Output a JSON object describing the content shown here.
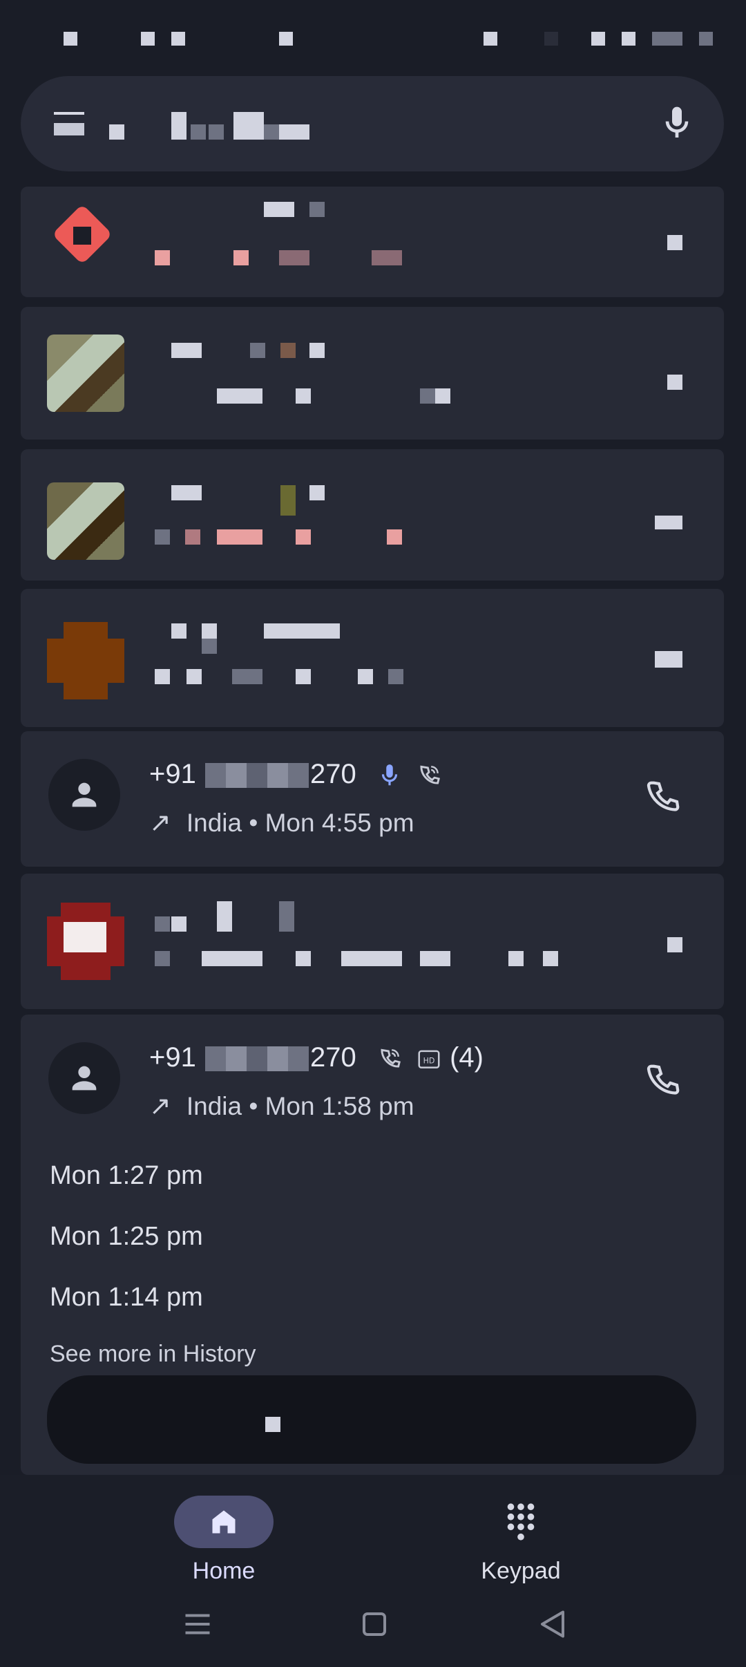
{
  "search": {
    "placeholder": "Search contacts",
    "mic_icon": "mic-icon"
  },
  "calls": [
    {
      "id": "call-1",
      "number_prefix": "+91",
      "number_suffix": "270",
      "direction_icon": "outgoing-arrow-icon",
      "meta": "India • Mon 4:55 pm",
      "indicator_icons": [
        "mic-icon",
        "wifi-call-icon"
      ]
    },
    {
      "id": "call-2",
      "number_prefix": "+91",
      "number_suffix": "270",
      "direction_icon": "outgoing-arrow-icon",
      "meta": "India • Mon 1:58 pm",
      "count": "(4)",
      "indicator_icons": [
        "wifi-call-icon",
        "hd-icon"
      ],
      "history": [
        "Mon 1:27 pm",
        "Mon 1:25 pm",
        "Mon 1:14 pm"
      ],
      "see_more": "See more in History"
    }
  ],
  "nav": {
    "items": [
      {
        "label": "Home",
        "icon": "home-icon",
        "active": true
      },
      {
        "label": "Keypad",
        "icon": "keypad-icon",
        "active": false
      }
    ]
  },
  "system_nav": [
    "recents-icon",
    "home-square-icon",
    "back-triangle-icon"
  ],
  "colors": {
    "background": "#1a1d27",
    "card": "#272a36",
    "nav_active_pill": "#4d4f72",
    "accent_mic": "#8aa5ff"
  }
}
